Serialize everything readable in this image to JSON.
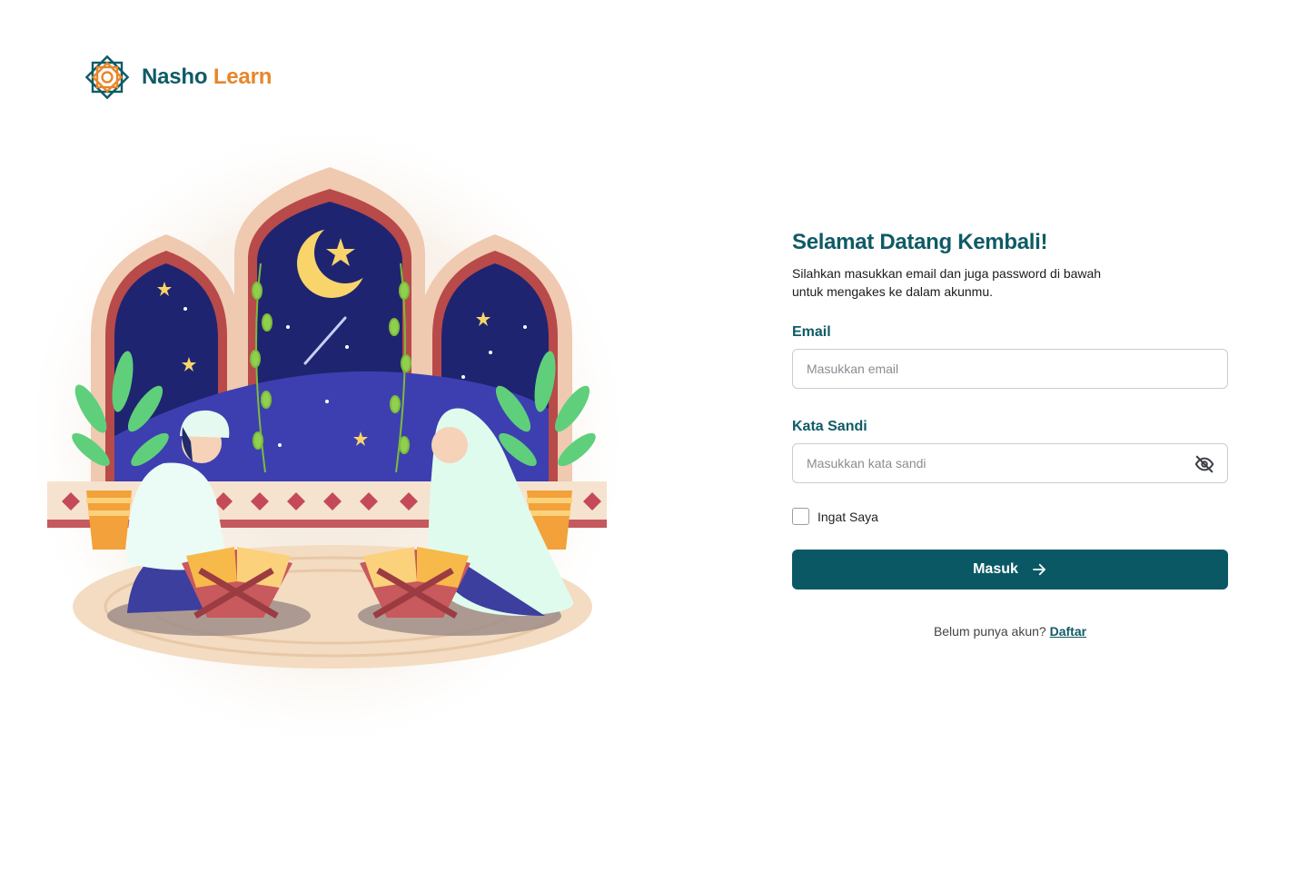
{
  "brand": {
    "name_part1": "Nasho",
    "name_part2": "Learn",
    "colors": {
      "primary": "#0f5b66",
      "accent": "#e7862a"
    },
    "logo_icon": "eight-point-star-logo-icon"
  },
  "form": {
    "title": "Selamat Datang Kembali!",
    "subtitle": "Silahkan masukkan email dan juga password di bawah untuk mengakes ke dalam akunmu.",
    "email": {
      "label": "Email",
      "placeholder": "Masukkan email",
      "value": ""
    },
    "password": {
      "label": "Kata Sandi",
      "placeholder": "Masukkan kata sandi",
      "value": "",
      "toggle_icon": "eye-off-icon"
    },
    "remember": {
      "label": "Ingat Saya",
      "checked": false
    },
    "submit": {
      "label": "Masuk",
      "icon": "arrow-right-icon",
      "color": "#0b5865"
    },
    "register": {
      "prompt": "Belum punya akun?",
      "link_label": "Daftar"
    }
  }
}
